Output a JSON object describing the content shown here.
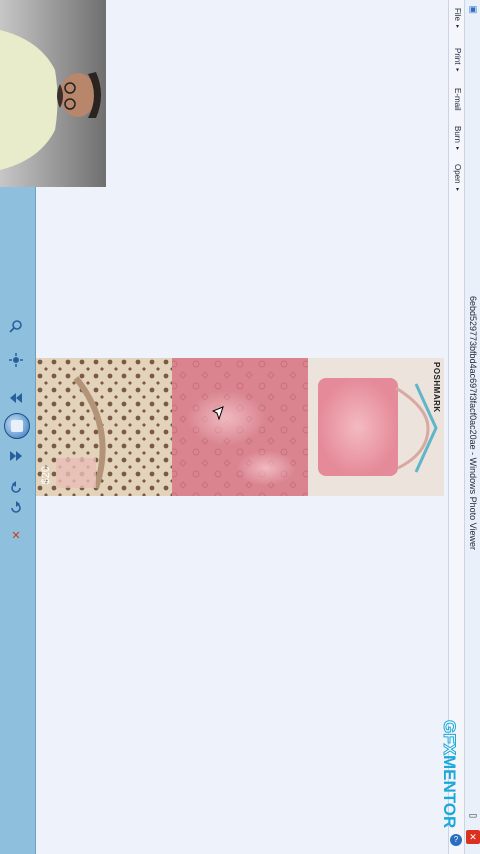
{
  "window": {
    "title": "6ebd529773bfbd4ac697f3facf0ac20ae - Windows Photo Viewer"
  },
  "menu": {
    "items": [
      {
        "label": "File",
        "caret": "▾"
      },
      {
        "label": "Print",
        "caret": "▾"
      },
      {
        "label": "E-mail",
        "caret": ""
      },
      {
        "label": "Burn",
        "caret": "▾"
      },
      {
        "label": "Open",
        "caret": "▾"
      }
    ]
  },
  "photo": {
    "price_label": "$20",
    "brand_label": "POSHMARK"
  },
  "watermark": {
    "text_part1": "GFX",
    "text_part2": "MENTOR"
  },
  "controls": {
    "close_glyph": "✕",
    "help_glyph": "?",
    "delete_glyph": "✕",
    "icons": [
      "zoom-icon",
      "actual-size-icon",
      "previous-icon",
      "play-slideshow-icon",
      "next-icon",
      "rotate-counterclockwise-icon",
      "rotate-clockwise-icon",
      "delete-icon"
    ]
  },
  "colors": {
    "control_bar": "#8ec0de",
    "canvas": "#eef2fb",
    "watermark_blue": "#1aa9d8",
    "close_red": "#d9301f"
  }
}
